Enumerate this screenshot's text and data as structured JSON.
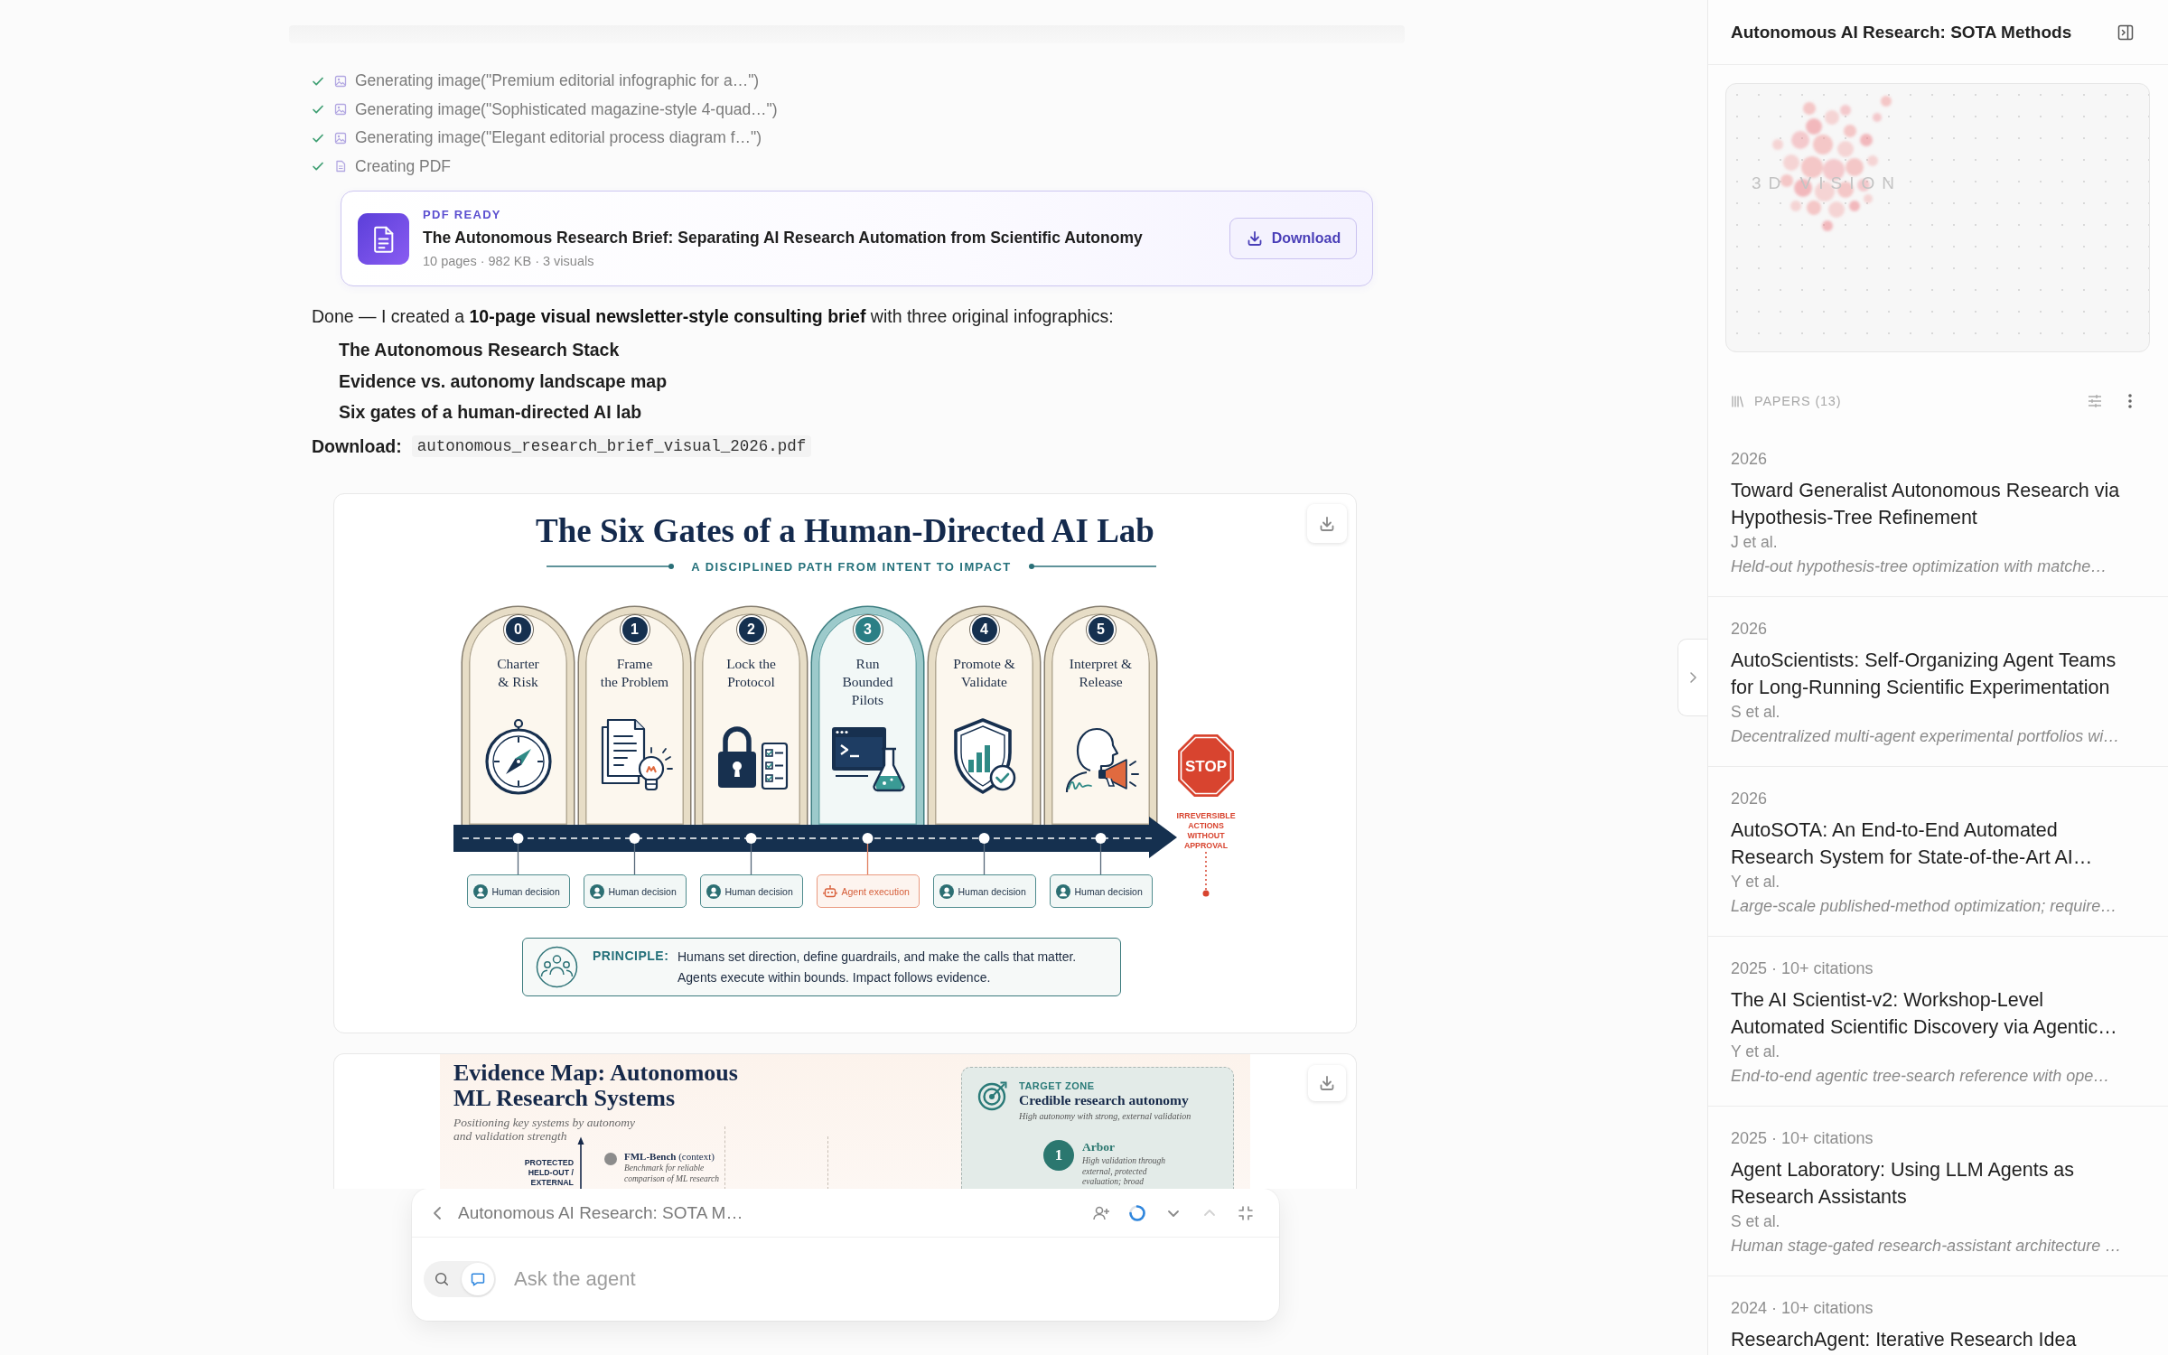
{
  "steps": [
    {
      "kind": "image",
      "label": "Generating image(\"Premium editorial infographic for a…\")",
      "done": true
    },
    {
      "kind": "image",
      "label": "Generating image(\"Sophisticated magazine-style 4-quad…\")",
      "done": true
    },
    {
      "kind": "image",
      "label": "Generating image(\"Elegant editorial process diagram f…\")",
      "done": true
    },
    {
      "kind": "document",
      "label": "Creating PDF",
      "done": true
    }
  ],
  "pdf_card": {
    "status": "PDF READY",
    "title": "The Autonomous Research Brief: Separating AI Research Automation from Scientific Autonomy",
    "meta": "10 pages · 982 KB · 3 visuals",
    "button": "Download"
  },
  "message": {
    "intro": "Done — I created a **10-page visual newsletter-style consulting brief** with three original infographics:",
    "items": [
      "The Autonomous Research Stack",
      "Evidence vs. autonomy landscape map",
      "Six gates of a human-directed AI lab"
    ],
    "download_label": "Download:",
    "filename": "autonomous_research_brief_visual_2026.pdf"
  },
  "gates_figure": {
    "title": "The Six Gates of a Human-Directed AI Lab",
    "subtitle": "A DISCIPLINED PATH FROM INTENT TO IMPACT",
    "gates": [
      {
        "number": "0",
        "label": "Charter\n& Risk",
        "kind": "human",
        "tag": "Human decision"
      },
      {
        "number": "1",
        "label": "Frame\nthe Problem",
        "kind": "human",
        "tag": "Human decision"
      },
      {
        "number": "2",
        "label": "Lock the\nProtocol",
        "kind": "human",
        "tag": "Human decision"
      },
      {
        "number": "3",
        "label": "Run\nBounded\nPilots",
        "kind": "agent",
        "tag": "Agent execution"
      },
      {
        "number": "4",
        "label": "Promote &\nValidate",
        "kind": "human",
        "tag": "Human decision"
      },
      {
        "number": "5",
        "label": "Interpret &\nRelease",
        "kind": "human",
        "tag": "Human decision"
      }
    ],
    "stop": {
      "sign": "STOP",
      "warning": "IRREVERSIBLE ACTIONS WITHOUT APPROVAL"
    },
    "principle": {
      "label": "PRINCIPLE:",
      "text": "Humans set direction, define guardrails, and make the calls that matter. Agents execute within bounds. Impact follows evidence."
    }
  },
  "evidence_figure": {
    "title": "Evidence Map: Autonomous\nML Research Systems",
    "subtitle": "Positioning key systems by autonomy\nand validation strength",
    "axis_label": "PROTECTED\nHELD-OUT /\nEXTERNAL",
    "systems": [
      {
        "name": "**FML-Bench** (context)",
        "description": "Benchmark for reliable\ncomparison of ML research",
        "color": "#8c8c8c"
      }
    ],
    "target_zone": {
      "label": "TARGET ZONE",
      "title": "Credible research autonomy",
      "caption": "High autonomy with strong, external validation",
      "entries": [
        {
          "rank": "1",
          "name": "Arbor",
          "description": "High validation through\nexternal, protected\nevaluation; broad"
        }
      ]
    }
  },
  "composer": {
    "title": "Autonomous AI Research: SOTA M…",
    "tools": [
      {
        "kind": "add-person",
        "disabled": false
      },
      {
        "kind": "progress",
        "disabled": false
      },
      {
        "kind": "down",
        "disabled": false
      },
      {
        "kind": "up",
        "disabled": true
      },
      {
        "kind": "collapse",
        "disabled": false
      }
    ],
    "modes": [
      {
        "kind": "search",
        "selected": false
      },
      {
        "kind": "chat",
        "selected": true
      }
    ],
    "placeholder": "Ask the agent"
  },
  "panel": {
    "title": "Autonomous AI Research: SOTA Methods",
    "visual_label": "3D VISION",
    "papers_header": "PAPERS (13)",
    "papers": [
      {
        "meta": "2026",
        "title": "Toward Generalist Autonomous Research via Hypothesis-Tree Refinement",
        "authors": "J et al.",
        "summary": "Held-out hypothesis-tree optimization with matche…"
      },
      {
        "meta": "2026",
        "title": "AutoScientists: Self-Organizing Agent Teams for Long-Running Scientific Experimentation",
        "authors": "S et al.",
        "summary": "Decentralized multi-agent experimental portfolios wi…"
      },
      {
        "meta": "2026",
        "title": "AutoSOTA: An End-to-End Automated Research System for State-of-the-Art AI…",
        "authors": "Y et al.",
        "summary": "Large-scale published-method optimization; require…"
      },
      {
        "meta": "2025 · 10+ citations",
        "title": "The AI Scientist-v2: Workshop-Level Automated Scientific Discovery via Agentic…",
        "authors": "Y et al.",
        "summary": "End-to-end agentic tree-search reference with ope…"
      },
      {
        "meta": "2025 · 10+ citations",
        "title": "Agent Laboratory: Using LLM Agents as Research Assistants",
        "authors": "S et al.",
        "summary": "Human stage-gated research-assistant architecture …"
      },
      {
        "meta": "2024 · 10+ citations",
        "title": "ResearchAgent: Iterative Research Idea"
      }
    ]
  }
}
